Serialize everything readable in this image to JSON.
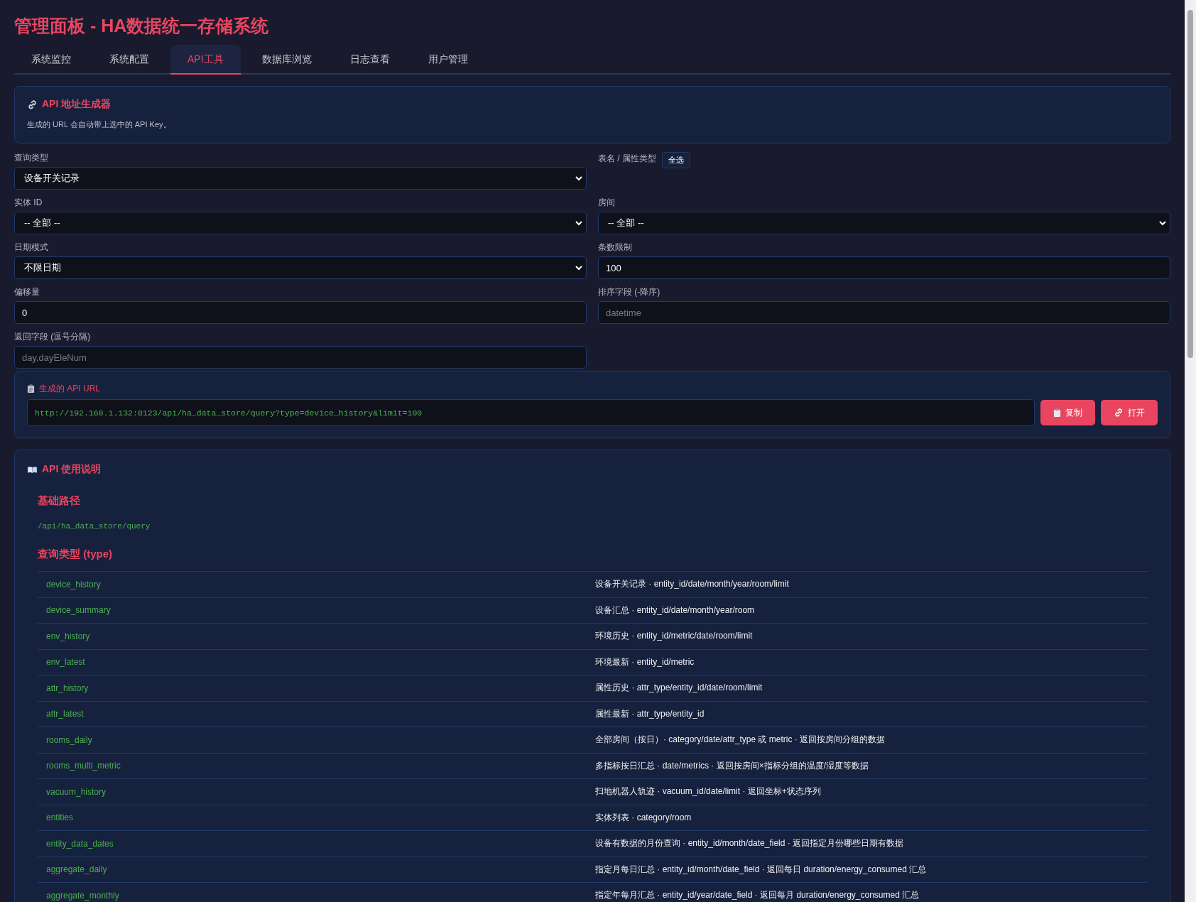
{
  "title": "管理面板 - HA数据统一存储系统",
  "tabs": [
    {
      "label": "系统监控",
      "selected": false
    },
    {
      "label": "系统配置",
      "selected": false
    },
    {
      "label": "API工具",
      "selected": true
    },
    {
      "label": "数据库浏览",
      "selected": false
    },
    {
      "label": "日志查看",
      "selected": false
    },
    {
      "label": "用户管理",
      "selected": false
    }
  ],
  "generator": {
    "title": "API 地址生成器",
    "note": "生成的 URL 会自动带上选中的 API Key。"
  },
  "fields": [
    {
      "label": "查询类型",
      "kind": "select",
      "value": "设备开关记录"
    },
    {
      "label": "表名 / 属性类型",
      "kind": "buttons",
      "button": "全选"
    },
    {
      "label": "实体 ID",
      "kind": "select",
      "value": "-- 全部 --"
    },
    {
      "label": "房间",
      "kind": "select",
      "value": "-- 全部 --"
    },
    {
      "label": "日期模式",
      "kind": "select",
      "value": "不限日期"
    },
    {
      "label": "条数限制",
      "kind": "input",
      "value": "100"
    },
    {
      "label": "偏移量",
      "kind": "input",
      "value": "0"
    },
    {
      "label": "排序字段 (-降序)",
      "kind": "input",
      "placeholder": "datetime"
    },
    {
      "label": "返回字段 (逗号分隔)",
      "kind": "input",
      "placeholder": "day,dayEleNum"
    }
  ],
  "url_box": {
    "title": "生成的 API URL",
    "url": "http://192.168.1.132:8123/api/ha_data_store/query?type=device_history&limit=100",
    "buttons": [
      {
        "label": "复制",
        "kind": "copy"
      },
      {
        "label": "打开",
        "kind": "open"
      }
    ]
  },
  "docs": {
    "title": "API 使用说明",
    "base_heading": "基础路径",
    "base_path": "/api/ha_data_store/query",
    "types_heading": "查询类型 (type)",
    "rows": [
      {
        "type": "device_history",
        "desc": "设备开关记录 · entity_id/date/month/year/room/limit"
      },
      {
        "type": "device_summary",
        "desc": "设备汇总 · entity_id/date/month/year/room"
      },
      {
        "type": "env_history",
        "desc": "环境历史 · entity_id/metric/date/room/limit"
      },
      {
        "type": "env_latest",
        "desc": "环境最新 · entity_id/metric"
      },
      {
        "type": "attr_history",
        "desc": "属性历史 · attr_type/entity_id/date/room/limit"
      },
      {
        "type": "attr_latest",
        "desc": "属性最新 · attr_type/entity_id"
      },
      {
        "type": "rooms_daily",
        "desc": "全部房间（按日）· category/date/attr_type 或 metric · 返回按房间分组的数据"
      },
      {
        "type": "rooms_multi_metric",
        "desc": "多指标按日汇总 · date/metrics · 返回按房间×指标分组的温度/湿度等数据"
      },
      {
        "type": "vacuum_history",
        "desc": "扫地机器人轨迹 · vacuum_id/date/limit · 返回坐标+状态序列"
      },
      {
        "type": "entities",
        "desc": "实体列表 · category/room"
      },
      {
        "type": "entity_data_dates",
        "desc": "设备有数据的月份查询 · entity_id/month/date_field · 返回指定月份哪些日期有数据"
      },
      {
        "type": "aggregate_daily",
        "desc": "指定月每日汇总 · entity_id/month/date_field · 返回每日 duration/energy_consumed 汇总"
      },
      {
        "type": "aggregate_monthly",
        "desc": "指定年每月汇总 · entity_id/year/date_field · 返回每月 duration/energy_consumed 汇总"
      }
    ]
  }
}
